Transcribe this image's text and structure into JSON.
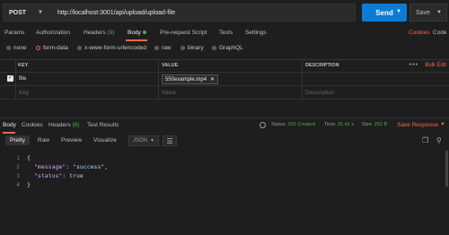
{
  "request": {
    "method": "POST",
    "url": "http://localhost:3001/api/upload/upload-file",
    "send_label": "Send",
    "save_label": "Save"
  },
  "req_tabs": {
    "params": "Params",
    "authorization": "Authorization",
    "headers": "Headers",
    "headers_count": "(9)",
    "body": "Body",
    "prerequest": "Pre-request Script",
    "tests": "Tests",
    "settings": "Settings",
    "cookies": "Cookies",
    "code": "Code"
  },
  "body_types": {
    "none": "none",
    "form_data": "form-data",
    "urlencoded": "x-www-form-urlencoded",
    "raw": "raw",
    "binary": "binary",
    "graphql": "GraphQL"
  },
  "kv_table": {
    "col_key": "KEY",
    "col_value": "VALUE",
    "col_description": "DESCRIPTION",
    "bulk_edit": "Bulk Edit",
    "row": {
      "key": "file",
      "value": "550example.mp4"
    },
    "placeholder_key": "Key",
    "placeholder_value": "Value",
    "placeholder_description": "Description"
  },
  "response": {
    "tab_body": "Body",
    "tab_cookies": "Cookies",
    "tab_headers": "Headers",
    "headers_count": "(6)",
    "tab_tests": "Test Results",
    "status_label": "Status:",
    "status_value": "201 Created",
    "time_label": "Time:",
    "time_value": "31.41 s",
    "size_label": "Size:",
    "size_value": "252 B",
    "save_response": "Save Response"
  },
  "resp_toolbar": {
    "pretty": "Pretty",
    "raw": "Raw",
    "preview": "Preview",
    "visualize": "Visualize",
    "format": "JSON"
  },
  "code_lines": [
    {
      "n": "1",
      "text": "{"
    },
    {
      "n": "2",
      "key": "\"message\"",
      "value": "\"success\"",
      "comma": ","
    },
    {
      "n": "3",
      "key": "\"status\"",
      "value": "true",
      "comma": ""
    },
    {
      "n": "4",
      "text": "}"
    }
  ],
  "colors": {
    "accent": "#ef6b4a",
    "send": "#0b7bd6",
    "success": "#4caf50",
    "background": "#1e1e1e"
  }
}
